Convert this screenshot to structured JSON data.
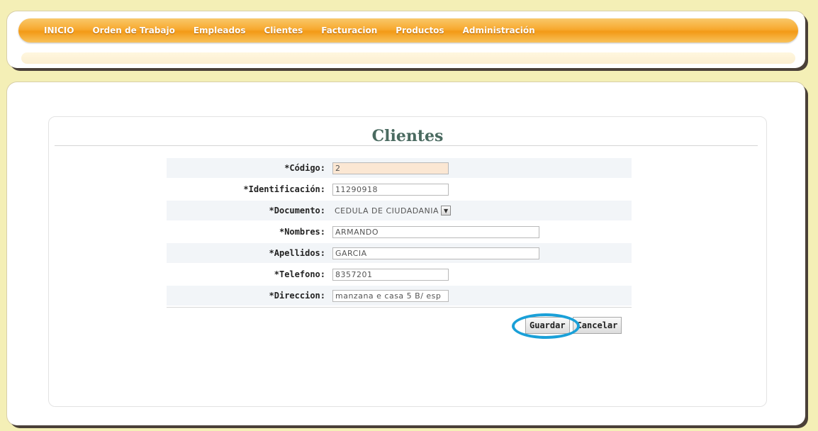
{
  "nav": {
    "items": [
      {
        "label": "INICIO"
      },
      {
        "label": "Orden de Trabajo"
      },
      {
        "label": "Empleados"
      },
      {
        "label": "Clientes"
      },
      {
        "label": "Facturacion"
      },
      {
        "label": "Productos"
      },
      {
        "label": "Administración"
      }
    ]
  },
  "form": {
    "title": "Clientes",
    "fields": [
      {
        "label": "*Código:",
        "value": "2"
      },
      {
        "label": "*Identificación:",
        "value": "11290918"
      },
      {
        "label": "*Documento:",
        "value": "CEDULA DE CIUDADANIA"
      },
      {
        "label": "*Nombres:",
        "value": "ARMANDO"
      },
      {
        "label": "*Apellidos:",
        "value": "GARCIA"
      },
      {
        "label": "*Telefono:",
        "value": "8357201"
      },
      {
        "label": "*Direccion:",
        "value": "manzana e casa 5 B/ esp"
      }
    ],
    "save_label": "Guardar",
    "cancel_label": "Cancelar"
  },
  "colors": {
    "nav_orange": "#f7a92f",
    "highlight_ring": "#1aa0d8",
    "title_green": "#4a6a60",
    "readonly_field": "#fbe7d3"
  }
}
